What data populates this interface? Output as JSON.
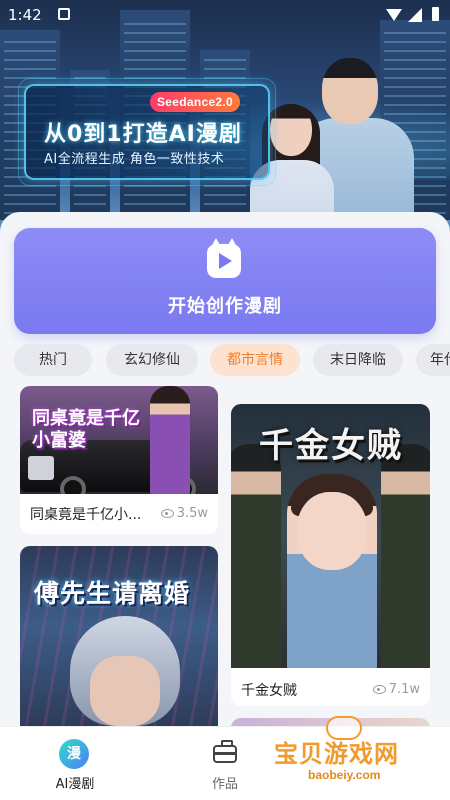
{
  "status_bar": {
    "time": "1:42"
  },
  "banner": {
    "badge": "Seedance2.0",
    "title": "从0到1打造AI漫剧",
    "subtitle": "AI全流程生成 角色一致性技术"
  },
  "create": {
    "label": "开始创作漫剧"
  },
  "categories": [
    {
      "label": "热门",
      "active": false
    },
    {
      "label": "玄幻修仙",
      "active": false
    },
    {
      "label": "都市言情",
      "active": true
    },
    {
      "label": "末日降临",
      "active": false
    },
    {
      "label": "年代",
      "active": false
    }
  ],
  "feed": {
    "left": [
      {
        "name": "同桌竟是千亿小...",
        "views": "3.5w",
        "poster_text": "同桌竟是千亿小富婆"
      },
      {
        "poster_text": "傅先生请离婚"
      }
    ],
    "right": [
      {
        "name": "千金女贼",
        "views": "7.1w",
        "poster_text": "千金女贼"
      }
    ]
  },
  "nav": [
    {
      "label": "AI漫剧",
      "icon": "manga-icon",
      "icon_text": "漫",
      "active": true
    },
    {
      "label": "作品",
      "icon": "briefcase-icon",
      "active": false
    }
  ],
  "watermark": {
    "text": "宝贝游戏网",
    "url": "baobeiy.com"
  },
  "colors": {
    "accent": "#7a79f0",
    "chip_active_bg": "#fde2cf",
    "chip_active_text": "#f07e2e"
  }
}
